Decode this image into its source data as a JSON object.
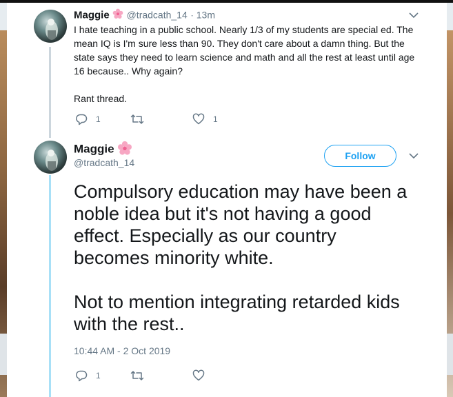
{
  "first_tweet": {
    "name": "Maggie",
    "handle": "@tradcath_14",
    "time": "· 13m",
    "text_line1": "I hate teaching in a public school. Nearly 1/3 of my students are special ed. The",
    "text_line2": "mean IQ is I'm sure less than 90. They don't care about a damn thing. But the",
    "text_line3": "state says they need to learn science and math and all the rest at least until age",
    "text_line4": "16 because.. Why again?",
    "text_line5": "Rant thread.",
    "reply_count": "1",
    "retweet_count": "",
    "like_count": "1"
  },
  "main_tweet": {
    "name": "Maggie",
    "handle": "@tradcath_14",
    "follow_label": "Follow",
    "text_line1": "Compulsory education may have been a",
    "text_line2": "noble idea but it's not having a good",
    "text_line3": "effect. Especially as our country",
    "text_line4": "becomes minority white.",
    "text_line5": "Not to mention integrating retarded kids",
    "text_line6": "with the rest..",
    "timestamp": "10:44 AM - 2 Oct 2019",
    "reply_count": "1",
    "retweet_count": "",
    "like_count": ""
  },
  "colors": {
    "accent": "#1da1f2",
    "muted": "#657786",
    "text": "#14171a"
  }
}
